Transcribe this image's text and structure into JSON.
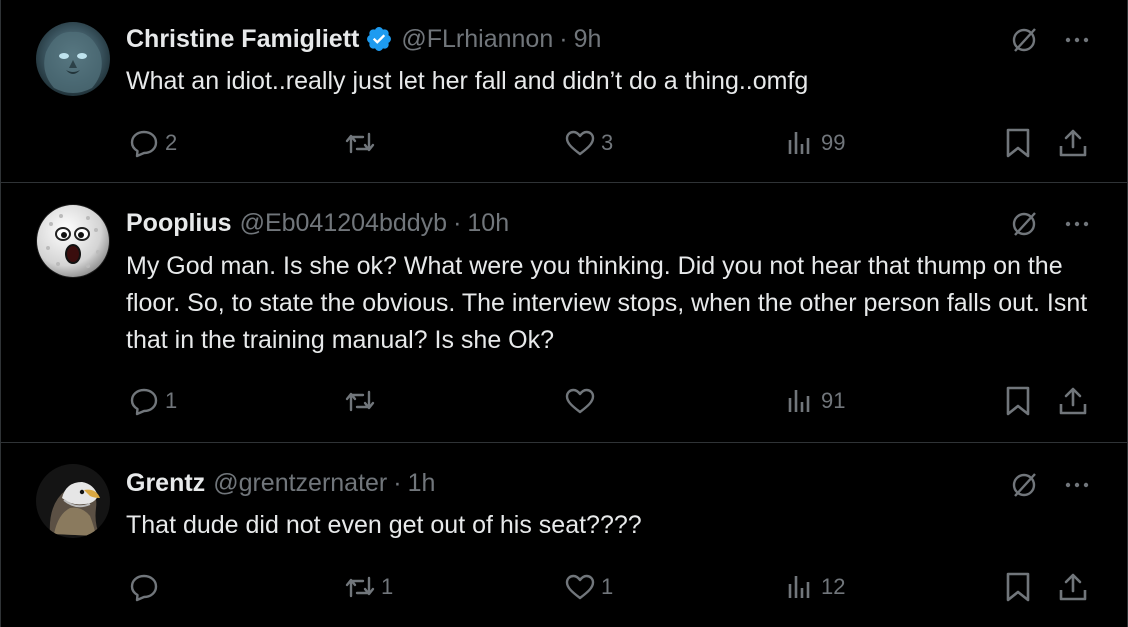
{
  "tweets": [
    {
      "name": "Christine Famigliett",
      "verified": true,
      "handle": "@FLrhiannon",
      "dot": "·",
      "time": "9h",
      "text": "What an idiot..really just let her fall and didn’t do a thing..omfg",
      "replies": "2",
      "retweets": "",
      "likes": "3",
      "views": "99"
    },
    {
      "name": "Pooplius",
      "verified": false,
      "handle": "@Eb041204bddyb",
      "dot": "·",
      "time": "10h",
      "text": "My God man. Is she ok? What were you thinking. Did you not hear that thump on the floor. So, to state the obvious. The interview stops, when the other person falls out. Isnt that in the training manual? Is she Ok?",
      "replies": "1",
      "retweets": "",
      "likes": "",
      "views": "91"
    },
    {
      "name": "Grentz",
      "verified": false,
      "handle": "@grentzernater",
      "dot": "·",
      "time": "1h",
      "text": "That dude did not even get out of his seat????",
      "replies": "",
      "retweets": "1",
      "likes": "1",
      "views": "12"
    }
  ],
  "colors": {
    "background": "#000000",
    "text_primary": "#e7e9ea",
    "text_secondary": "#71767b",
    "border": "#2f3336",
    "verified_badge": "#1d9bf0"
  },
  "icons": [
    "grok-icon",
    "more-icon",
    "reply-icon",
    "retweet-icon",
    "like-icon",
    "views-icon",
    "bookmark-icon",
    "share-icon",
    "verified-icon"
  ]
}
